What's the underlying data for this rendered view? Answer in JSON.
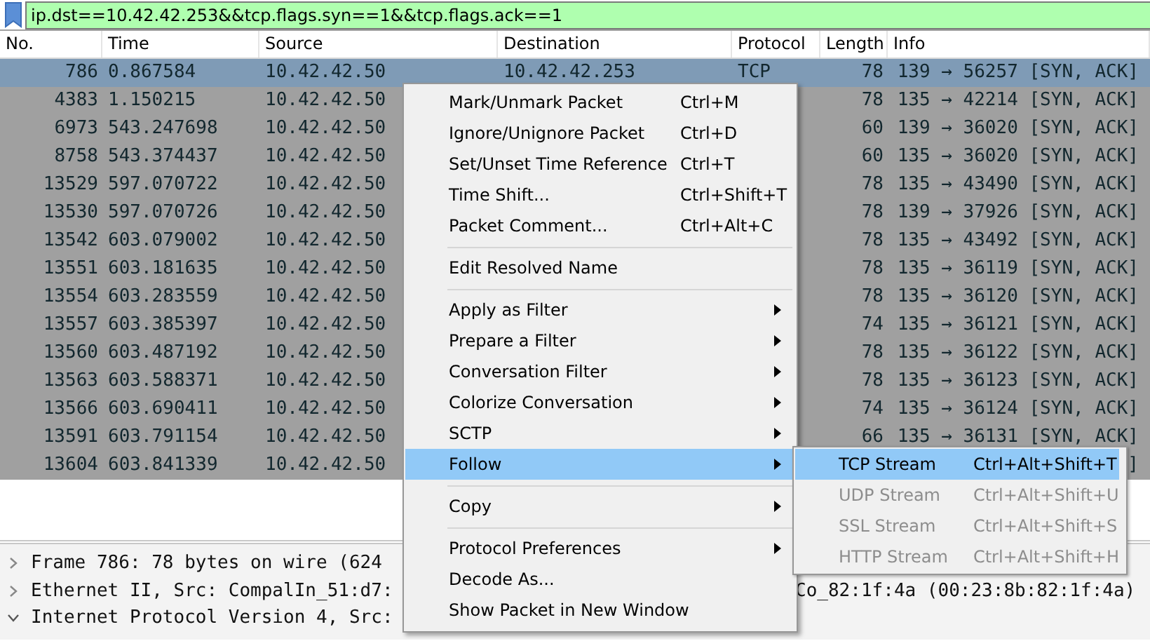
{
  "filter_bar": {
    "value": "ip.dst==10.42.42.253&&tcp.flags.syn==1&&tcp.flags.ack==1"
  },
  "packet_list": {
    "columns": [
      "No.",
      "Time",
      "Source",
      "Destination",
      "Protocol",
      "Length",
      "Info"
    ],
    "rows": [
      {
        "no": "786",
        "time": "0.867584",
        "source": "10.42.42.50",
        "destination": "10.42.42.253",
        "protocol": "TCP",
        "length": "78",
        "info": "139 → 56257 [SYN, ACK]",
        "selected": true
      },
      {
        "no": "4383",
        "time": "1.150215",
        "source": "10.42.42.50",
        "length": "78",
        "info": "135 → 42214 [SYN, ACK]",
        "selected": false
      },
      {
        "no": "6973",
        "time": "543.247698",
        "source": "10.42.42.50",
        "length": "60",
        "info": "139 → 36020 [SYN, ACK]",
        "selected": false
      },
      {
        "no": "8758",
        "time": "543.374437",
        "source": "10.42.42.50",
        "length": "60",
        "info": "135 → 36020 [SYN, ACK]",
        "selected": false
      },
      {
        "no": "13529",
        "time": "597.070722",
        "source": "10.42.42.50",
        "length": "78",
        "info": "135 → 43490 [SYN, ACK]",
        "selected": false
      },
      {
        "no": "13530",
        "time": "597.070726",
        "source": "10.42.42.50",
        "length": "78",
        "info": "139 → 37926 [SYN, ACK]",
        "selected": false
      },
      {
        "no": "13542",
        "time": "603.079002",
        "source": "10.42.42.50",
        "length": "78",
        "info": "135 → 43492 [SYN, ACK]",
        "selected": false
      },
      {
        "no": "13551",
        "time": "603.181635",
        "source": "10.42.42.50",
        "length": "78",
        "info": "135 → 36119 [SYN, ACK]",
        "selected": false
      },
      {
        "no": "13554",
        "time": "603.283559",
        "source": "10.42.42.50",
        "length": "78",
        "info": "135 → 36120 [SYN, ACK]",
        "selected": false
      },
      {
        "no": "13557",
        "time": "603.385397",
        "source": "10.42.42.50",
        "length": "74",
        "info": "135 → 36121 [SYN, ACK]",
        "selected": false
      },
      {
        "no": "13560",
        "time": "603.487192",
        "source": "10.42.42.50",
        "length": "78",
        "info": "135 → 36122 [SYN, ACK]",
        "selected": false
      },
      {
        "no": "13563",
        "time": "603.588371",
        "source": "10.42.42.50",
        "length": "78",
        "info": "135 → 36123 [SYN, ACK]",
        "selected": false
      },
      {
        "no": "13566",
        "time": "603.690411",
        "source": "10.42.42.50",
        "length": "74",
        "info": "135 → 36124 [SYN, ACK]",
        "selected": false
      },
      {
        "no": "13591",
        "time": "603.791154",
        "source": "10.42.42.50",
        "length": "66",
        "info": "135 → 36131 [SYN, ACK]",
        "selected": false
      },
      {
        "no": "13604",
        "time": "603.841339",
        "source": "10.42.42.50",
        "info": "]",
        "selected": false
      }
    ]
  },
  "packet_details": [
    {
      "text": "Frame 786: 78 bytes on wire (624",
      "expanded": false
    },
    {
      "text": "Ethernet II, Src: CompalIn_51:d7:",
      "text_right": "Co_82:1f:4a (00:23:8b:82:1f:4a)",
      "expanded": false
    },
    {
      "text": "Internet Protocol Version 4, Src:",
      "expanded": true
    }
  ],
  "context_menu": {
    "items": [
      {
        "kind": "action",
        "label": "Mark/Unmark Packet",
        "shortcut": "Ctrl+M",
        "selected": false
      },
      {
        "kind": "action",
        "label": "Ignore/Unignore Packet",
        "shortcut": "Ctrl+D",
        "selected": false
      },
      {
        "kind": "action",
        "label": "Set/Unset Time Reference",
        "shortcut": "Ctrl+T",
        "selected": false
      },
      {
        "kind": "action",
        "label": "Time Shift...",
        "shortcut": "Ctrl+Shift+T",
        "selected": false
      },
      {
        "kind": "action",
        "label": "Packet Comment...",
        "shortcut": "Ctrl+Alt+C",
        "selected": false
      },
      {
        "kind": "separator"
      },
      {
        "kind": "action",
        "label": "Edit Resolved Name",
        "selected": false
      },
      {
        "kind": "separator"
      },
      {
        "kind": "submenu",
        "label": "Apply as Filter",
        "selected": false
      },
      {
        "kind": "submenu",
        "label": "Prepare a Filter",
        "selected": false
      },
      {
        "kind": "submenu",
        "label": "Conversation Filter",
        "selected": false
      },
      {
        "kind": "submenu",
        "label": "Colorize Conversation",
        "selected": false
      },
      {
        "kind": "submenu",
        "label": "SCTP",
        "selected": false
      },
      {
        "kind": "submenu",
        "label": "Follow",
        "selected": true
      },
      {
        "kind": "separator"
      },
      {
        "kind": "submenu",
        "label": "Copy",
        "selected": false
      },
      {
        "kind": "separator"
      },
      {
        "kind": "submenu",
        "label": "Protocol Preferences",
        "selected": false
      },
      {
        "kind": "action",
        "label": "Decode As...",
        "selected": false
      },
      {
        "kind": "action",
        "label": "Show Packet in New Window",
        "selected": false
      }
    ]
  },
  "submenu": {
    "items": [
      {
        "label": "TCP Stream",
        "shortcut": "Ctrl+Alt+Shift+T",
        "selected": true,
        "disabled": false
      },
      {
        "label": "UDP Stream",
        "shortcut": "Ctrl+Alt+Shift+U",
        "selected": false,
        "disabled": true
      },
      {
        "label": "SSL Stream",
        "shortcut": "Ctrl+Alt+Shift+S",
        "selected": false,
        "disabled": true
      },
      {
        "label": "HTTP Stream",
        "shortcut": "Ctrl+Alt+Shift+H",
        "selected": false,
        "disabled": true
      }
    ]
  }
}
